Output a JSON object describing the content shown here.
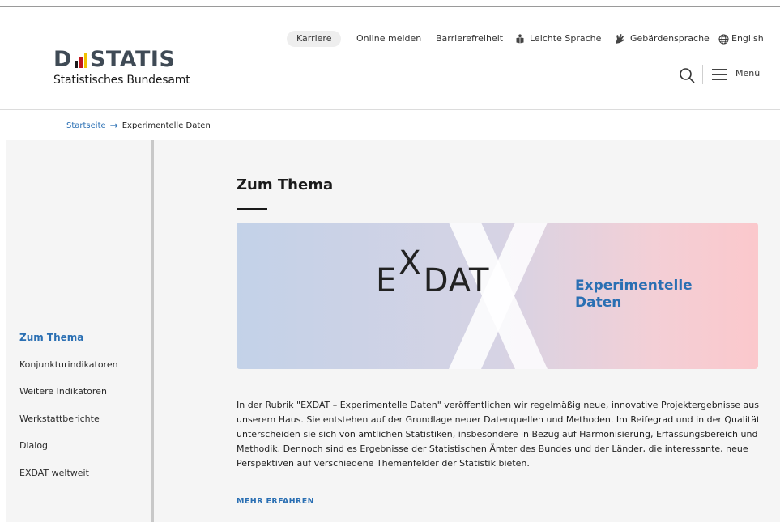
{
  "logo": {
    "word_left": "D",
    "word_right": "STATIS",
    "subtitle": "Statistisches Bundesamt",
    "bar_colors": [
      "#1a1a1a",
      "#c0161c",
      "#f2c200"
    ]
  },
  "topnav": {
    "karriere": "Karriere",
    "online_melden": "Online melden",
    "barrierefreiheit": "Barrierefreiheit",
    "leichte_sprache": "Leichte Sprache",
    "gebaerdensprache": "Gebärdensprache",
    "english": "English"
  },
  "header": {
    "menu_label": "Menü"
  },
  "breadcrumb": {
    "home": "Startseite",
    "arrow": "→",
    "current": "Experimentelle Daten"
  },
  "sidebar": {
    "items": [
      {
        "label": "Zum Thema",
        "active": true
      },
      {
        "label": "Konjunkturindikatoren",
        "active": false
      },
      {
        "label": "Weitere Indikatoren",
        "active": false
      },
      {
        "label": "Werkstattberichte",
        "active": false
      },
      {
        "label": "Dialog",
        "active": false
      },
      {
        "label": "EXDAT weltweit",
        "active": false
      }
    ]
  },
  "main": {
    "title": "Zum Thema",
    "banner": {
      "logo_e": "E",
      "logo_x": "X",
      "logo_dat": "DAT",
      "title": "Experimentelle Daten"
    },
    "body": "In der Rubrik \"EXDAT – Experimentelle Daten\" veröffentlichen wir regelmäßig neue, innovative Projektergebnisse aus unserem Haus. Sie entstehen auf der Grundlage neuer Datenquellen und Methoden. Im Reifegrad und in der Qualität unterscheiden sie sich von amtlichen Statistiken, insbesondere in Bezug auf Harmonisierung, Erfassungsbereich und Methodik. Dennoch sind es Ergebnisse der Statistischen Ämter des Bundes und der Länder, die interessante, neue Perspektiven auf verschiedene Themenfelder der Statistik bieten.",
    "more_link": "MEHR ERFAHREN"
  },
  "colors": {
    "accent": "#2a6fb3",
    "sidebar_bg": "#f5f5f5",
    "divider": "#c8c8c8"
  }
}
